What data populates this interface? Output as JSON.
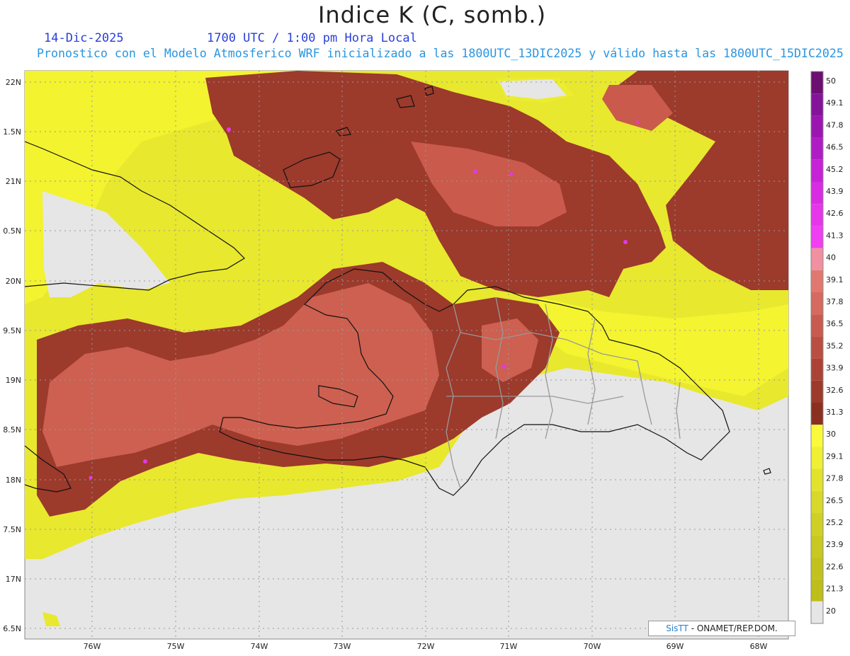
{
  "header": {
    "title": "Indice K (C, somb.)",
    "date": "14-Dic-2025",
    "time": "1700 UTC / 1:00 pm Hora Local",
    "description": "Pronostico con el Modelo Atmosferico WRF inicializado a las 1800UTC_13DIC2025 y válido hasta las  1800UTC_15DIC2025"
  },
  "map": {
    "lat_labels": [
      "22N",
      "1.5N",
      "21N",
      "0.5N",
      "20N",
      "9.5N",
      "19N",
      "8.5N",
      "18N",
      "7.5N",
      "17N",
      "6.5N"
    ],
    "lon_labels": [
      "76W",
      "75W",
      "74W",
      "73W",
      "72W",
      "71W",
      "70W",
      "69W",
      "68W"
    ],
    "background_color": "#e6e6e6",
    "gridlines": "dotted"
  },
  "colorbar": {
    "labels": [
      "50",
      "49.1",
      "47.8",
      "46.5",
      "45.2",
      "43.9",
      "42.6",
      "41.3",
      "40",
      "39.1",
      "37.8",
      "36.5",
      "35.2",
      "33.9",
      "32.6",
      "31.3",
      "30",
      "29.1",
      "27.8",
      "26.5",
      "25.2",
      "23.9",
      "22.6",
      "21.3",
      "20"
    ],
    "colors": [
      "#6c0f70",
      "#84139a",
      "#9b16b0",
      "#b01cc4",
      "#c623d6",
      "#d82ce2",
      "#e636ea",
      "#f03ef2",
      "#f090a0",
      "#e07870",
      "#d46a60",
      "#c85a50",
      "#ba4e42",
      "#ab4236",
      "#9c3a2c",
      "#8a3020",
      "#fafa3a",
      "#efef34",
      "#e2e22c",
      "#d8d82a",
      "#cfd026",
      "#c8c822",
      "#c2c21e",
      "#bebe1a",
      "#e6e6e6"
    ]
  },
  "credit": {
    "brand": "SisTT",
    "text": " - ONAMET/REP.DOM."
  }
}
